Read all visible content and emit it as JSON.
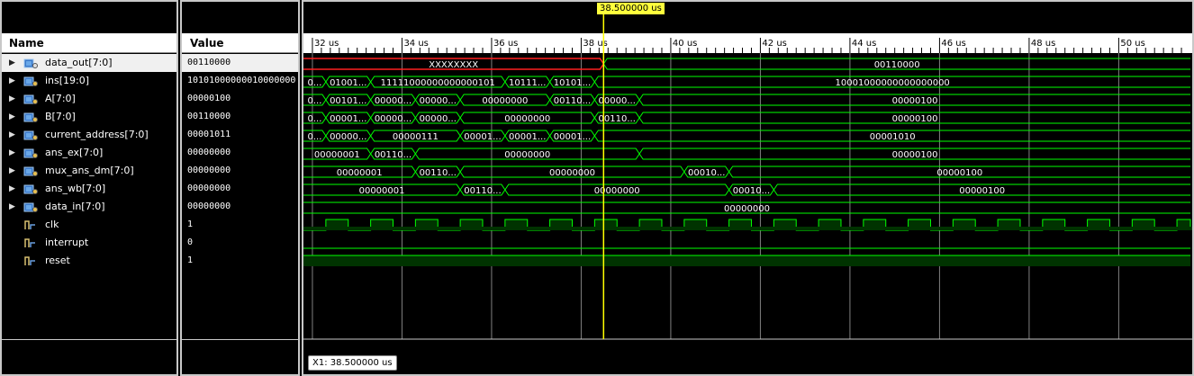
{
  "panels": {
    "name_header": "Name",
    "value_header": "Value"
  },
  "cursor": {
    "label": "38.500000 us",
    "time_us": 38.5,
    "readout": "X1: 38.500000 us"
  },
  "timeline": {
    "start_us": 31.8,
    "end_us": 51.6,
    "ticks": [
      "32 us",
      "34 us",
      "36 us",
      "38 us",
      "40 us",
      "42 us",
      "44 us",
      "46 us",
      "48 us",
      "50 us"
    ],
    "tick_values": [
      32,
      34,
      36,
      38,
      40,
      42,
      44,
      46,
      48,
      50
    ]
  },
  "colors": {
    "bus": "#00ff00",
    "bus_fill": "#003300",
    "undefined": "#ff2020",
    "cursor": "#ffff00",
    "grid": "#808080"
  },
  "signals": [
    {
      "name": "data_out[7:0]",
      "value": "00110000",
      "type": "bus",
      "icon": "bus-output-icon",
      "selected": true
    },
    {
      "name": "ins[19:0]",
      "value": "10101000000010000000",
      "type": "bus",
      "icon": "bus-input-icon"
    },
    {
      "name": "A[7:0]",
      "value": "00000100",
      "type": "bus",
      "icon": "bus-input-icon"
    },
    {
      "name": "B[7:0]",
      "value": "00110000",
      "type": "bus",
      "icon": "bus-input-icon"
    },
    {
      "name": "current_address[7:0]",
      "value": "00001011",
      "type": "bus",
      "icon": "bus-input-icon"
    },
    {
      "name": "ans_ex[7:0]",
      "value": "00000000",
      "type": "bus",
      "icon": "bus-input-icon"
    },
    {
      "name": "mux_ans_dm[7:0]",
      "value": "00000000",
      "type": "bus",
      "icon": "bus-input-icon"
    },
    {
      "name": "ans_wb[7:0]",
      "value": "00000000",
      "type": "bus",
      "icon": "bus-input-icon"
    },
    {
      "name": "data_in[7:0]",
      "value": "00000000",
      "type": "bus",
      "icon": "bus-input-icon"
    },
    {
      "name": "clk",
      "value": "1",
      "type": "bit",
      "icon": "bit-signal-icon"
    },
    {
      "name": "interrupt",
      "value": "0",
      "type": "bit",
      "icon": "bit-signal-icon"
    },
    {
      "name": "reset",
      "value": "1",
      "type": "bit",
      "icon": "bit-signal-icon"
    }
  ],
  "waves": {
    "data_out": [
      {
        "t0": 31.8,
        "t1": 38.5,
        "label": "XXXXXXXX",
        "undef": true
      },
      {
        "t0": 38.5,
        "t1": 51.6,
        "label": "00110000"
      }
    ],
    "ins": [
      {
        "t0": 31.8,
        "t1": 32.3,
        "label": "0..."
      },
      {
        "t0": 32.3,
        "t1": 33.3,
        "label": "01001..."
      },
      {
        "t0": 33.3,
        "t1": 36.3,
        "label": "11111000000000000101"
      },
      {
        "t0": 36.3,
        "t1": 37.3,
        "label": "10111..."
      },
      {
        "t0": 37.3,
        "t1": 38.3,
        "label": "10101..."
      },
      {
        "t0": 38.3,
        "t1": 51.6,
        "label": "10001000000000000000"
      }
    ],
    "A": [
      {
        "t0": 31.8,
        "t1": 32.3,
        "label": "0..."
      },
      {
        "t0": 32.3,
        "t1": 33.3,
        "label": "00101..."
      },
      {
        "t0": 33.3,
        "t1": 34.3,
        "label": "00000..."
      },
      {
        "t0": 34.3,
        "t1": 35.3,
        "label": "00000..."
      },
      {
        "t0": 35.3,
        "t1": 37.3,
        "label": "00000000"
      },
      {
        "t0": 37.3,
        "t1": 38.3,
        "label": "00110..."
      },
      {
        "t0": 38.3,
        "t1": 39.3,
        "label": "00000..."
      },
      {
        "t0": 39.3,
        "t1": 51.6,
        "label": "00000100"
      }
    ],
    "B": [
      {
        "t0": 31.8,
        "t1": 32.3,
        "label": "0..."
      },
      {
        "t0": 32.3,
        "t1": 33.3,
        "label": "00001..."
      },
      {
        "t0": 33.3,
        "t1": 34.3,
        "label": "00000..."
      },
      {
        "t0": 34.3,
        "t1": 35.3,
        "label": "00000..."
      },
      {
        "t0": 35.3,
        "t1": 38.3,
        "label": "00000000"
      },
      {
        "t0": 38.3,
        "t1": 39.3,
        "label": "00110..."
      },
      {
        "t0": 39.3,
        "t1": 51.6,
        "label": "00000100"
      }
    ],
    "current_address": [
      {
        "t0": 31.8,
        "t1": 32.3,
        "label": "0..."
      },
      {
        "t0": 32.3,
        "t1": 33.3,
        "label": "00000..."
      },
      {
        "t0": 33.3,
        "t1": 35.3,
        "label": "00000111"
      },
      {
        "t0": 35.3,
        "t1": 36.3,
        "label": "00001..."
      },
      {
        "t0": 36.3,
        "t1": 37.3,
        "label": "00001..."
      },
      {
        "t0": 37.3,
        "t1": 38.3,
        "label": "00001..."
      },
      {
        "t0": 38.3,
        "t1": 51.6,
        "label": "00001010"
      }
    ],
    "ans_ex": [
      {
        "t0": 31.8,
        "t1": 33.3,
        "label": "00000001"
      },
      {
        "t0": 33.3,
        "t1": 34.3,
        "label": "00110..."
      },
      {
        "t0": 34.3,
        "t1": 39.3,
        "label": "00000000"
      },
      {
        "t0": 39.3,
        "t1": 51.6,
        "label": "00000100"
      }
    ],
    "mux_ans_dm": [
      {
        "t0": 31.8,
        "t1": 34.3,
        "label": "00000001"
      },
      {
        "t0": 34.3,
        "t1": 35.3,
        "label": "00110..."
      },
      {
        "t0": 35.3,
        "t1": 40.3,
        "label": "00000000"
      },
      {
        "t0": 40.3,
        "t1": 41.3,
        "label": "00010..."
      },
      {
        "t0": 41.3,
        "t1": 51.6,
        "label": "00000100"
      }
    ],
    "ans_wb": [
      {
        "t0": 31.8,
        "t1": 35.3,
        "label": "00000001"
      },
      {
        "t0": 35.3,
        "t1": 36.3,
        "label": "00110..."
      },
      {
        "t0": 36.3,
        "t1": 41.3,
        "label": "00000000"
      },
      {
        "t0": 41.3,
        "t1": 42.3,
        "label": "00010..."
      },
      {
        "t0": 42.3,
        "t1": 51.6,
        "label": "00000100"
      }
    ],
    "data_in": [
      {
        "t0": 31.8,
        "t1": 51.6,
        "label": "00000000"
      }
    ],
    "clk": {
      "period_us": 1.0,
      "high_from_offset": 0.5,
      "first_edge_us": 32.3
    },
    "interrupt": {
      "level": 0
    },
    "reset": {
      "level": 1
    }
  }
}
